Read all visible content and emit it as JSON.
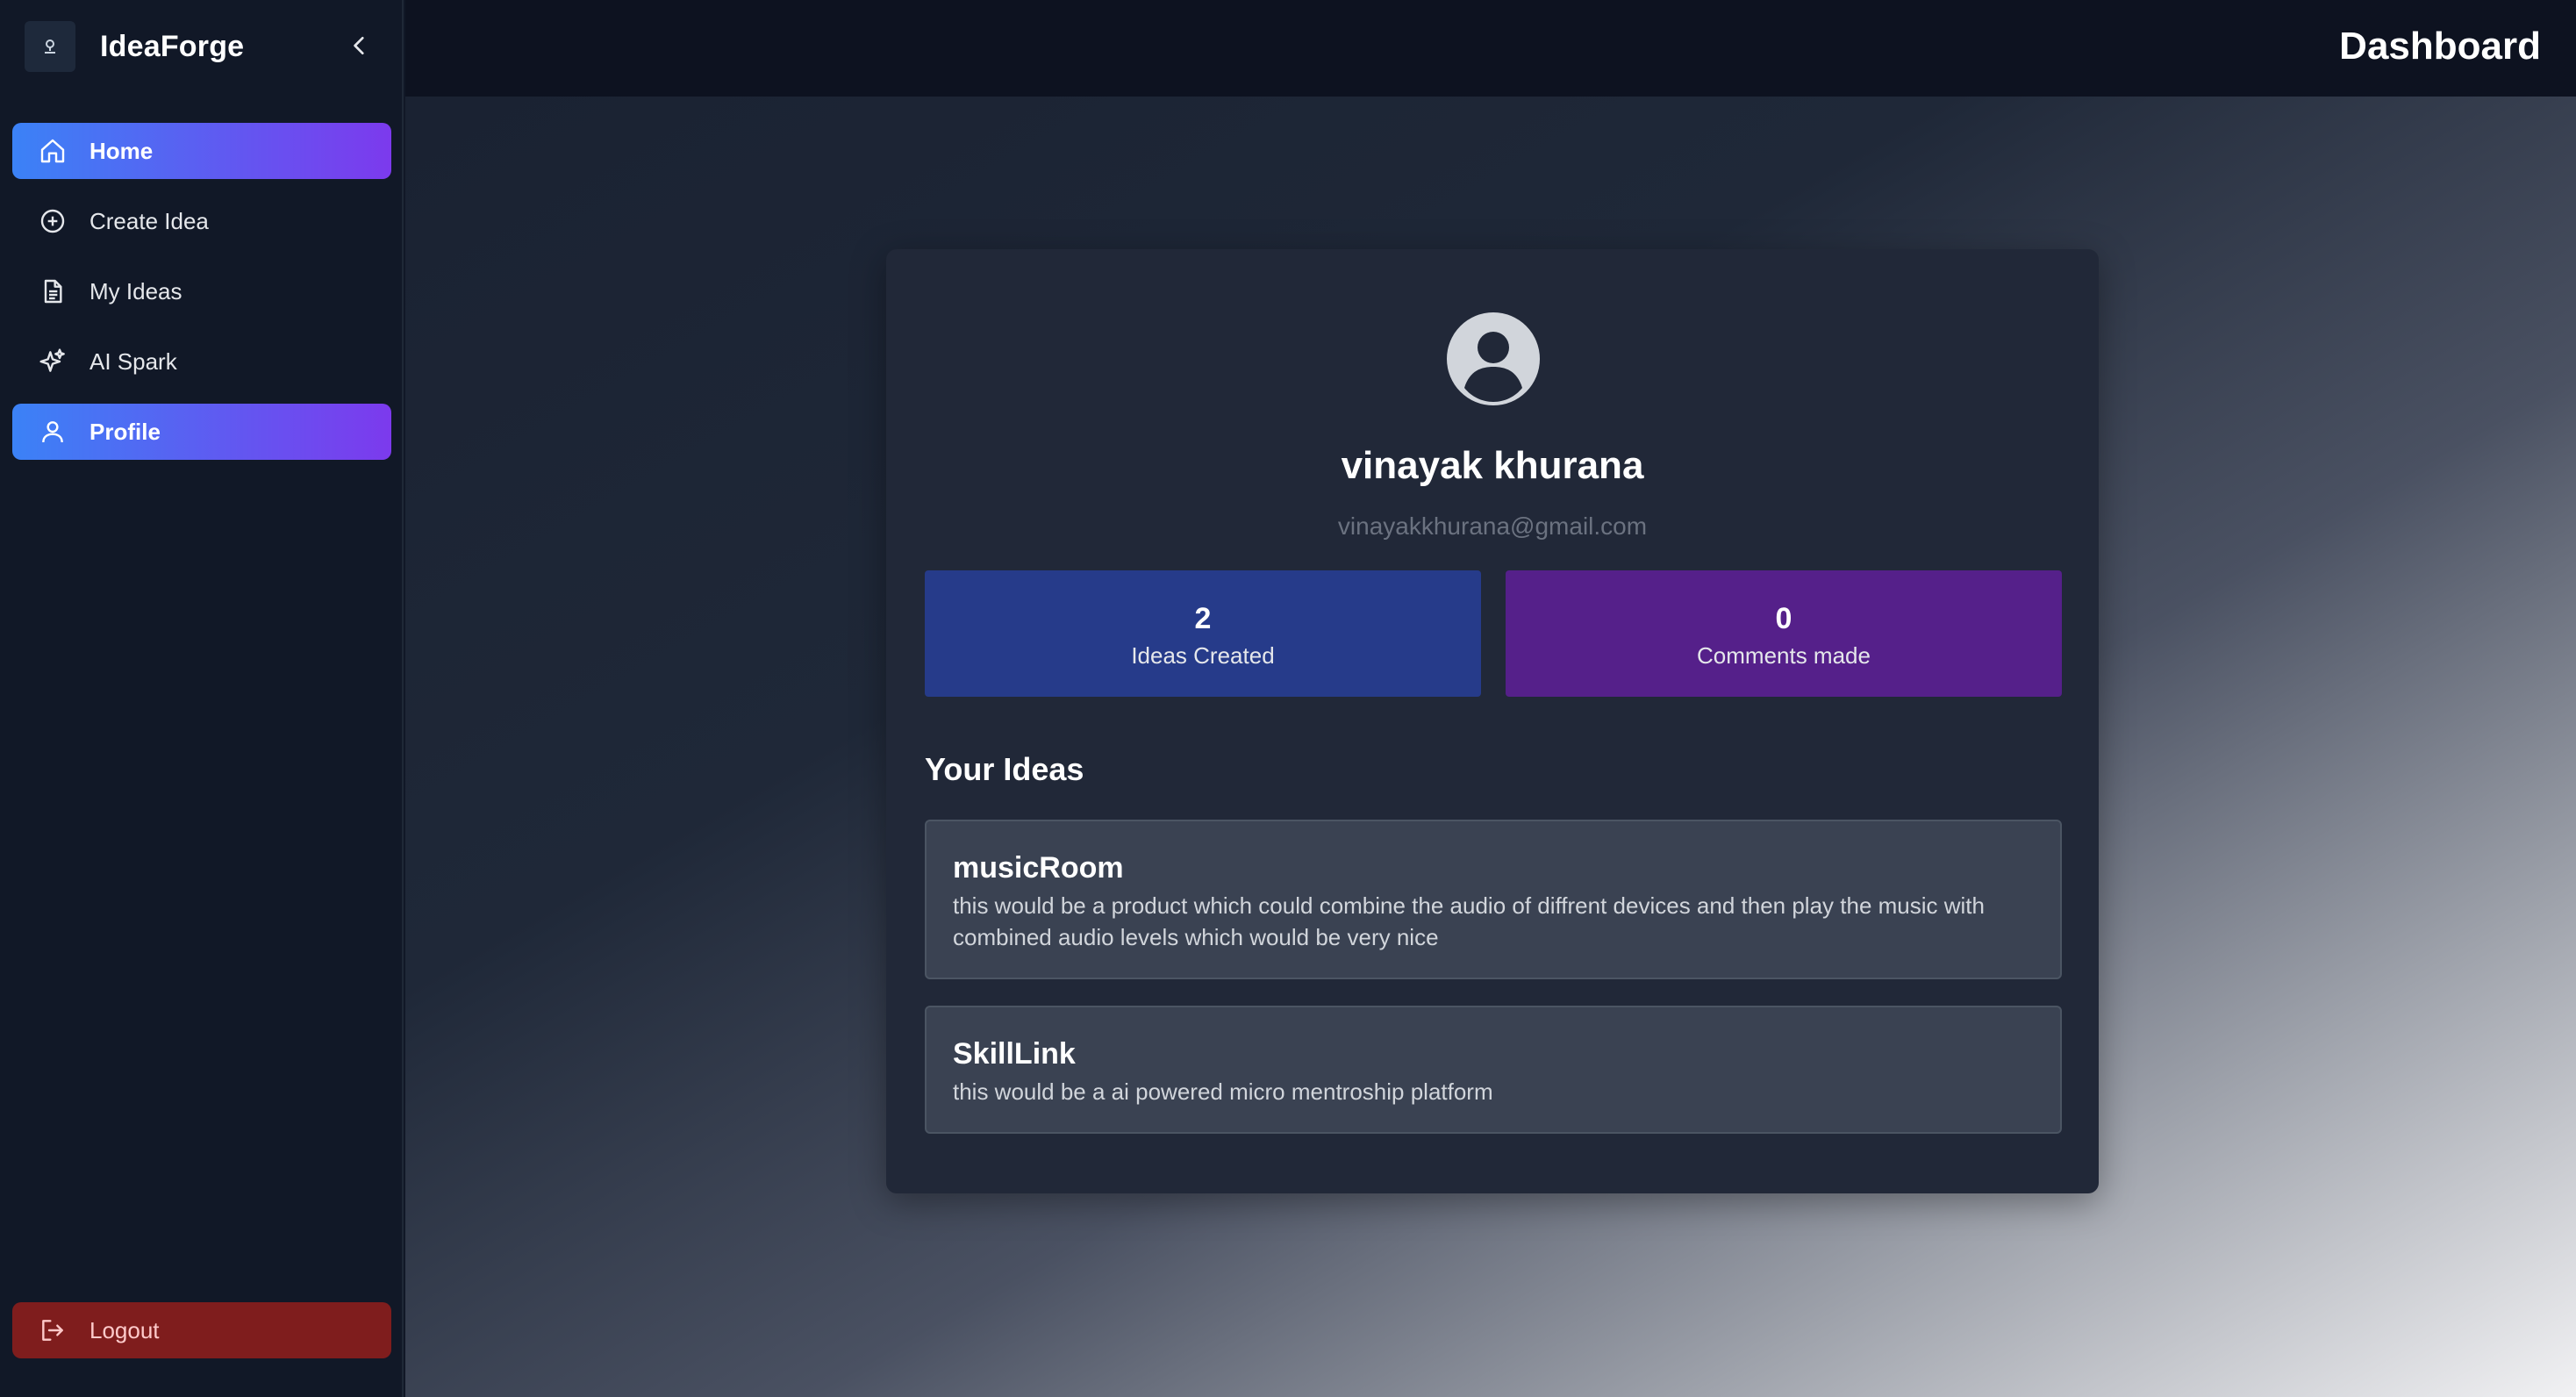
{
  "app": {
    "name": "IdeaForge"
  },
  "header": {
    "title": "Dashboard"
  },
  "sidebar": {
    "items": [
      {
        "label": "Home",
        "icon": "home-icon",
        "active": true
      },
      {
        "label": "Create Idea",
        "icon": "plus-circle-icon",
        "active": false
      },
      {
        "label": "My Ideas",
        "icon": "document-icon",
        "active": false
      },
      {
        "label": "AI Spark",
        "icon": "sparkles-icon",
        "active": false
      },
      {
        "label": "Profile",
        "icon": "user-icon",
        "active": true
      }
    ],
    "logout_label": "Logout"
  },
  "profile": {
    "name": "vinayak khurana",
    "email": "vinayakkhurana@gmail.com",
    "stats": [
      {
        "value": "2",
        "label": "Ideas Created"
      },
      {
        "value": "0",
        "label": "Comments made"
      }
    ]
  },
  "ideas": {
    "title": "Your Ideas",
    "items": [
      {
        "title": "musicRoom",
        "description": "this would be a product which could combine the audio of diffrent devices and then play the music with combined audio levels which would be very nice"
      },
      {
        "title": "SkillLink",
        "description": "this would be a ai powered micro mentroship platform"
      }
    ]
  },
  "colors": {
    "active_gradient_start": "#3b82f6",
    "active_gradient_end": "#7c3aed",
    "ideas_stat": "#263b8a",
    "comments_stat": "#55208a",
    "logout": "#7f1d1d"
  }
}
